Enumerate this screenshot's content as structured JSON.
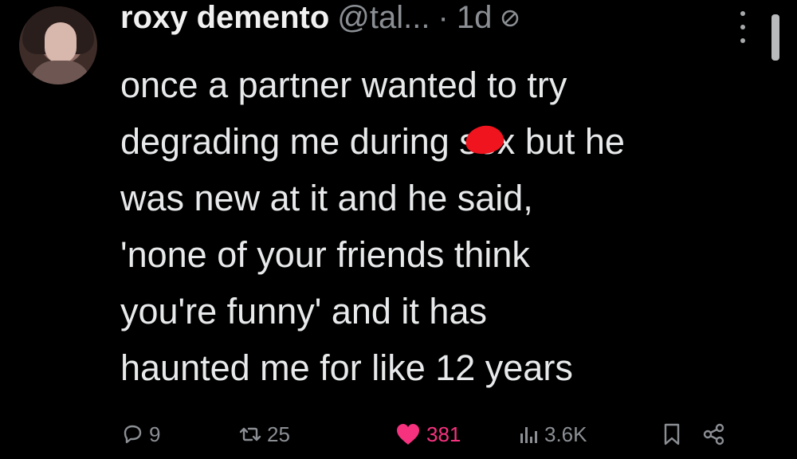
{
  "tweet": {
    "author_name": "roxy demento",
    "handle": "@tal...",
    "separator": "·",
    "time": "1d",
    "lines": [
      "once a partner wanted to try",
      "degrading me during ",
      "was new at it and he said,",
      "'none of your friends think",
      "you're funny' and it has",
      "haunted me for like 12 years"
    ],
    "redacted_word": "sex",
    "after_redaction": " but he"
  },
  "actions": {
    "replies": "9",
    "reposts": "25",
    "likes": "381",
    "views": "3.6K"
  },
  "colors": {
    "background": "#000000",
    "text": "#e7e9ea",
    "muted": "#8b8f94",
    "like": "#f6327f",
    "redaction": "#f0141e"
  }
}
